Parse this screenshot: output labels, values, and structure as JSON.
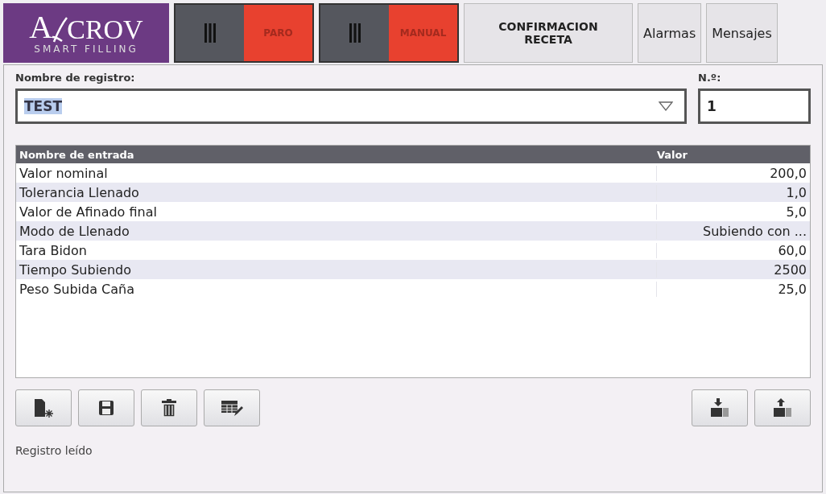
{
  "logo": {
    "initial": "A",
    "name": "CROV",
    "tagline": "SMART FILLING"
  },
  "mode_switches": [
    {
      "label": "PARO",
      "color": "#e8412f"
    },
    {
      "label": "MANUAL",
      "color": "#e8412f"
    }
  ],
  "nav_buttons": [
    {
      "label": "CONFIRMACION\nRECETA",
      "kind": "bold"
    },
    {
      "label": "Alarmas",
      "kind": "plain"
    },
    {
      "label": "Mensajes",
      "kind": "plain"
    }
  ],
  "record": {
    "name_label": "Nombre de registro:",
    "name_value": "TEST",
    "value_selected": true,
    "number_label": "N.º:",
    "number_value": "1"
  },
  "table": {
    "columns": [
      "Nombre de entrada",
      "Valor"
    ],
    "rows": [
      {
        "name": "Valor nominal",
        "value": "200,0"
      },
      {
        "name": "Tolerancia Llenado",
        "value": "1,0"
      },
      {
        "name": "Valor de Afinado final",
        "value": "5,0"
      },
      {
        "name": "Modo de Llenado",
        "value": "Subiendo con ..."
      },
      {
        "name": "Tara Bidon",
        "value": "60,0"
      },
      {
        "name": "Tiempo Subiendo",
        "value": "2500"
      },
      {
        "name": "Peso Subida Caña",
        "value": "25,0"
      }
    ]
  },
  "status_bar": "Registro leído"
}
